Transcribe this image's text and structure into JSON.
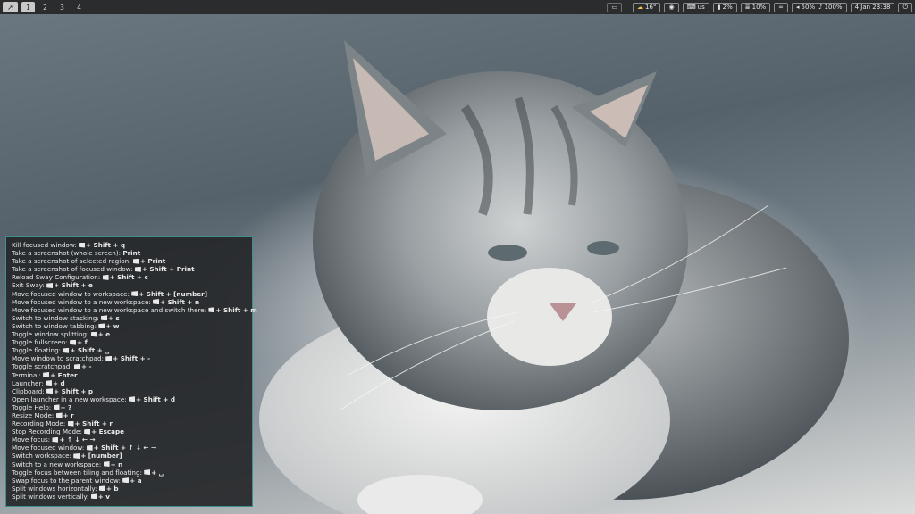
{
  "topbar": {
    "workspaces": [
      {
        "label": "1",
        "active": true
      },
      {
        "label": "2",
        "active": false
      },
      {
        "label": "3",
        "active": false
      },
      {
        "label": "4",
        "active": false
      }
    ],
    "weather": "16°",
    "keyboard_layout": "us",
    "cpu": "2%",
    "memory": "10%",
    "volume": "50%",
    "mic": "100%",
    "clock": "4 Jan 23:38",
    "icons": {
      "launcher": "rocket-icon",
      "notifications": "message-icon",
      "weather": "cloud-sun-icon",
      "idle": "eye-icon",
      "keyboard": "keyboard-icon",
      "cpu": "chip-icon",
      "memory": "memory-icon",
      "network": "link-icon",
      "volume": "speaker-icon",
      "mic": "microphone-icon",
      "power": "power-icon"
    }
  },
  "help": {
    "lines": [
      {
        "text": "Kill focused window: ",
        "win": true,
        "keys": "+ Shift + q"
      },
      {
        "text": "Take a screenshot (whole screen): ",
        "win": false,
        "keys": "Print"
      },
      {
        "text": "Take a screenshot of selected region: ",
        "win": true,
        "keys": "+ Print"
      },
      {
        "text": "Take a screenshot of focused window: ",
        "win": true,
        "keys": "+ Shift + Print"
      },
      {
        "text": "Reload Sway Configuration: ",
        "win": true,
        "keys": "+ Shift + c"
      },
      {
        "text": "Exit Sway: ",
        "win": true,
        "keys": "+ Shift + e"
      },
      {
        "text": "Move focused window to workspace: ",
        "win": true,
        "keys": "+ Shift + [number]"
      },
      {
        "text": "Move focused window to a new workspace: ",
        "win": true,
        "keys": "+ Shift + n"
      },
      {
        "text": "Move focused window to a new workspace and switch there: ",
        "win": true,
        "keys": "+ Shift + m"
      },
      {
        "text": "Switch to window stacking: ",
        "win": true,
        "keys": "+ s"
      },
      {
        "text": "Switch to window tabbing: ",
        "win": true,
        "keys": "+ w"
      },
      {
        "text": "Toggle window splitting: ",
        "win": true,
        "keys": "+ e"
      },
      {
        "text": "Toggle fullscreen: ",
        "win": true,
        "keys": "+ f"
      },
      {
        "text": "Toggle floating: ",
        "win": true,
        "keys": "+ Shift + ␣"
      },
      {
        "text": "Move window to scratchpad: ",
        "win": true,
        "keys": "+ Shift + -"
      },
      {
        "text": "Toggle scratchpad: ",
        "win": true,
        "keys": "+ -"
      },
      {
        "text": "Terminal: ",
        "win": true,
        "keys": "+ Enter"
      },
      {
        "text": "Launcher: ",
        "win": true,
        "keys": "+ d"
      },
      {
        "text": "Clipboard: ",
        "win": true,
        "keys": "+ Shift + p"
      },
      {
        "text": "Open launcher in a new workspace: ",
        "win": true,
        "keys": "+ Shift + d"
      },
      {
        "text": "Toggle Help: ",
        "win": true,
        "keys": "+ ?"
      },
      {
        "text": "Resize Mode: ",
        "win": true,
        "keys": "+ r"
      },
      {
        "text": "Recording Mode: ",
        "win": true,
        "keys": "+ Shift + r"
      },
      {
        "text": "Stop Recording Mode: ",
        "win": true,
        "keys": "+ Escape"
      },
      {
        "text": "Move focus: ",
        "win": true,
        "keys": "+ ↑ ↓ ← →"
      },
      {
        "text": "Move focused window: ",
        "win": true,
        "keys": "+ Shift + ↑ ↓ ← →"
      },
      {
        "text": "Switch workspace: ",
        "win": true,
        "keys": "+ [number]"
      },
      {
        "text": "Switch to a new workspace: ",
        "win": true,
        "keys": "+ n"
      },
      {
        "text": "Toggle focus between tiling and floating: ",
        "win": true,
        "keys": "+ ␣"
      },
      {
        "text": "Swap focus to the parent window: ",
        "win": true,
        "keys": "+ a"
      },
      {
        "text": "Split windows horizontally: ",
        "win": true,
        "keys": "+ b"
      },
      {
        "text": "Split windows vertically: ",
        "win": true,
        "keys": "+ v"
      }
    ]
  }
}
